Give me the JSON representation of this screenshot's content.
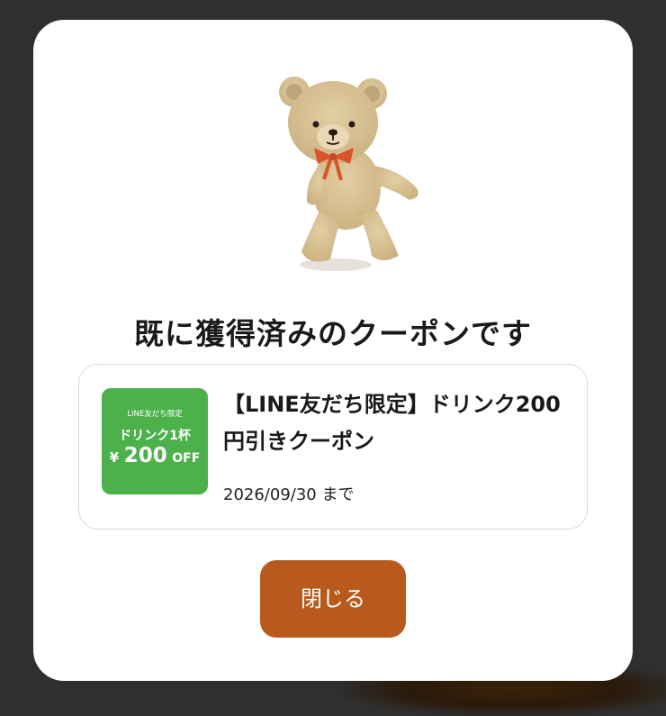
{
  "modal": {
    "title": "既に獲得済みのクーポンです",
    "close_label": "閉じる"
  },
  "coupon": {
    "title": "【LINE友だち限定】ドリンク200円引きクーポン",
    "expiry": "2026/09/30 まで",
    "thumbnail": {
      "tag": "LINE友だち限定",
      "item": "ドリンク1杯",
      "currency": "¥",
      "amount": "200",
      "off": "OFF",
      "color": "#4cb14b"
    }
  },
  "colors": {
    "accent": "#b85a1e",
    "backdrop": "#2f2f2f"
  },
  "illustration": "teddy-bear-icon"
}
